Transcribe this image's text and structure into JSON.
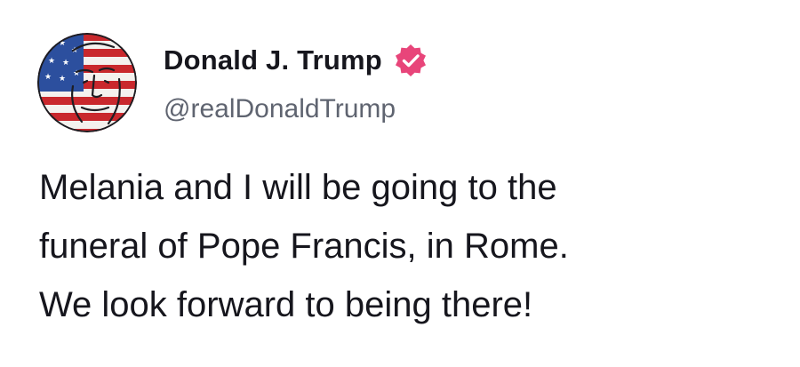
{
  "post": {
    "author": {
      "display_name": "Donald J. Trump",
      "handle": "@realDonaldTrump",
      "verified_icon": "verified-badge-icon",
      "verified_color": "#e8457a",
      "avatar_icon": "flag-portrait-avatar"
    },
    "body_lines": [
      "Melania and I will be going to the",
      "funeral of Pope Francis, in Rome.",
      "We look forward to being there!"
    ]
  }
}
